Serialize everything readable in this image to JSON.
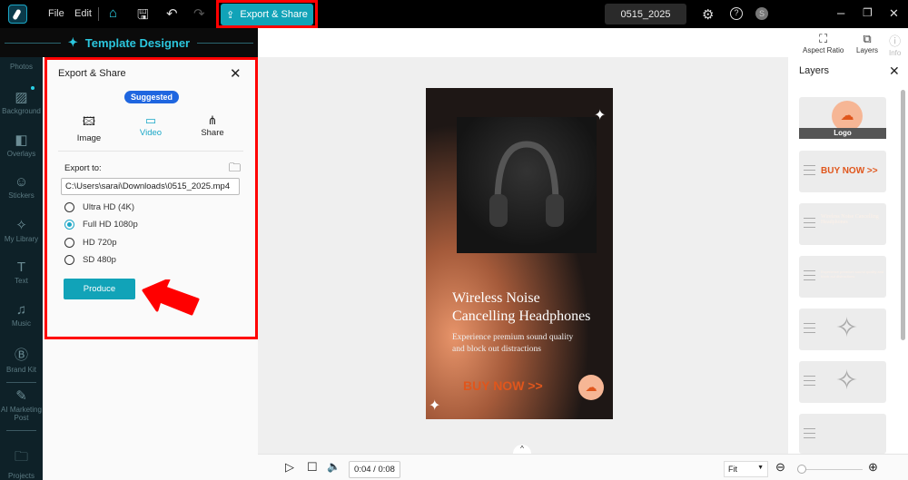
{
  "topbar": {
    "menu": [
      "File",
      "Edit"
    ],
    "export_label": "Export & Share",
    "project_name": "0515_2025",
    "avatar_initial": "S"
  },
  "header": {
    "title": "Template Designer"
  },
  "toolbar": {
    "aspect_ratio": "Aspect Ratio",
    "layers": "Layers",
    "info": "Info"
  },
  "sidebar": {
    "items": [
      "Photos",
      "Background",
      "Overlays",
      "Stickers",
      "My Library",
      "Text",
      "Music",
      "Brand Kit",
      "AI Marketing Post",
      "Projects"
    ]
  },
  "export_panel": {
    "title": "Export & Share",
    "badge": "Suggested",
    "tabs": [
      "Image",
      "Video",
      "Share"
    ],
    "active_tab": "Video",
    "export_to_label": "Export to:",
    "path": "C:\\Users\\sarai\\Downloads\\0515_2025.mp4",
    "resolutions": [
      "Ultra HD (4K)",
      "Full HD 1080p",
      "HD 720p",
      "SD 480p"
    ],
    "selected": "Full HD 1080p",
    "produce": "Produce"
  },
  "poster": {
    "title_line1": "Wireless Noise",
    "title_line2": "Cancelling Headphones",
    "subtitle_line1": "Experience premium sound quality",
    "subtitle_line2": "and block out distractions",
    "cta": "BUY NOW >>"
  },
  "layers": {
    "title": "Layers",
    "logo_label": "Logo",
    "cta": "BUY NOW >>",
    "title_text": "Wireless Noise Cancelling Headphones",
    "subtitle_text": "Experience premium sound quality and block out distractions"
  },
  "playback": {
    "time": "0:04 / 0:08",
    "zoom": "Fit"
  },
  "colors": {
    "accent": "#11a3b8",
    "cta": "#e0561c",
    "highlight": "#ff0000"
  }
}
